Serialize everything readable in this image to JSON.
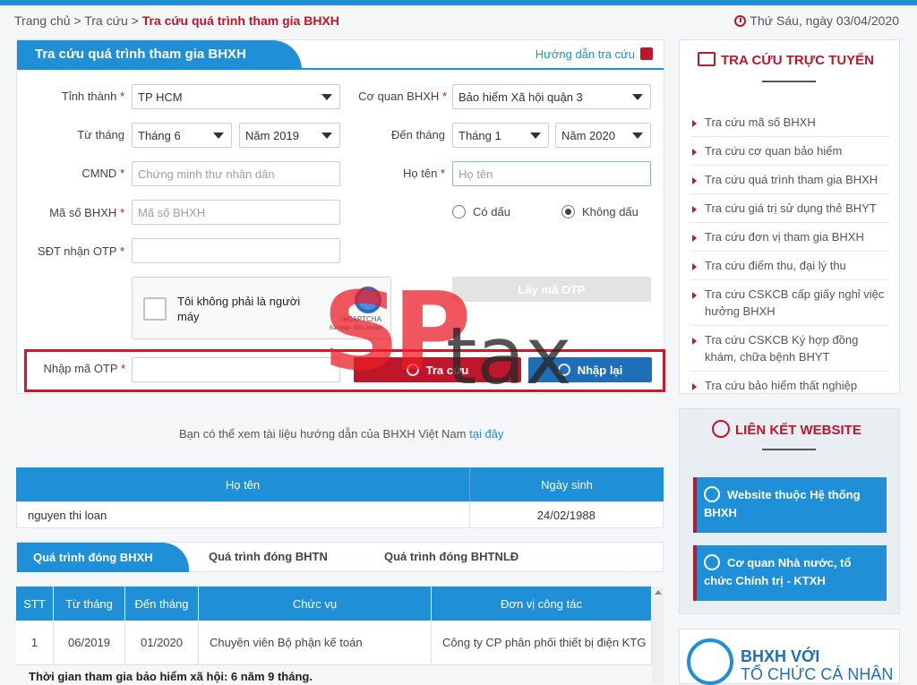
{
  "breadcrumb": {
    "home": "Trang chủ >",
    "lookup": "Tra cứu >",
    "current": "Tra cứu quá trình tham gia BHXH"
  },
  "date": "Thứ Sáu, ngày 03/04/2020",
  "panel": {
    "title": "Tra cứu quá trình tham gia BHXH",
    "guide": "Hướng dẫn tra cứu"
  },
  "form": {
    "province_label": "Tỉnh thành",
    "province_value": "TP HCM",
    "agency_label": "Cơ quan BHXH",
    "agency_value": "Bảo hiểm Xã hội quận 3",
    "from_label": "Từ tháng",
    "from_month": "Tháng 6",
    "from_year": "Năm 2019",
    "to_label": "Đến tháng",
    "to_month": "Tháng 1",
    "to_year": "Năm 2020",
    "cmnd_label": "CMND",
    "cmnd_placeholder": "Chứng minh thư nhân dân",
    "name_label": "Họ tên",
    "name_placeholder": "Họ tên",
    "bhxh_label": "Mã số BHXH",
    "bhxh_placeholder": "Mã số BHXH",
    "radio_accent": "Có dấu",
    "radio_no_accent": "Không dấu",
    "phone_label": "SĐT nhận OTP",
    "captcha_text": "Tôi không phải là người máy",
    "captcha_brand": "reCAPTCHA",
    "captcha_terms": "Bảo mật - Điều khoản",
    "get_otp": "Lấy mã OTP",
    "otp_label": "Nhập mã OTP",
    "search_btn": "Tra cứu",
    "reset_btn": "Nhập lại",
    "required": "*"
  },
  "watermark": {
    "part1": "SP",
    "part2": "tax"
  },
  "note": {
    "text": "Bạn có thể xem tài liệu hướng dẫn của BHXH Việt Nam ",
    "link": "tại đây"
  },
  "person_table": {
    "headers": [
      "Họ tên",
      "Ngày sinh"
    ],
    "row": [
      "nguyen thi loan",
      "24/02/1988"
    ]
  },
  "tabs": [
    "Quá trình đóng BHXH",
    "Quá trình đóng BHTN",
    "Quá trình đóng BHTNLĐ"
  ],
  "history_table": {
    "headers": [
      "STT",
      "Từ tháng",
      "Đến tháng",
      "Chức vụ",
      "Đơn vị công tác"
    ],
    "row": [
      "1",
      "06/2019",
      "01/2020",
      "Chuyên viên Bộ phận kế toán",
      "Công ty CP phân phối thiết bị điện KTG"
    ]
  },
  "total": "Thời gian tham gia bảo hiểm xã hội: 6 năm 9 tháng.",
  "sidebar": {
    "title": "TRA CỨU TRỰC TUYẾN",
    "items": [
      "Tra cứu mã số BHXH",
      "Tra cứu cơ quan bảo hiểm",
      "Tra cứu quá trình tham gia BHXH",
      "Tra cứu giá trị sử dụng thẻ BHYT",
      "Tra cứu đơn vị tham gia BHXH",
      "Tra cứu điểm thu, đại lý thu",
      "Tra cứu CSKCB cấp giấy nghỉ việc hưởng BHXH",
      "Tra cứu CSKCB Ký hợp đồng khám, chữa bệnh BHYT",
      "Tra cứu bảo hiểm thất nghiệp"
    ]
  },
  "links": {
    "title": "LIÊN KẾT WEBSITE",
    "btn1": "Website thuộc Hệ thống BHXH",
    "btn2": "Cơ quan Nhà nước, tổ chức Chính trị - KTXH"
  },
  "bhxh_banner": {
    "line1": "BHXH VỚI",
    "line2": "TỔ CHỨC CÁ NHÂN"
  }
}
